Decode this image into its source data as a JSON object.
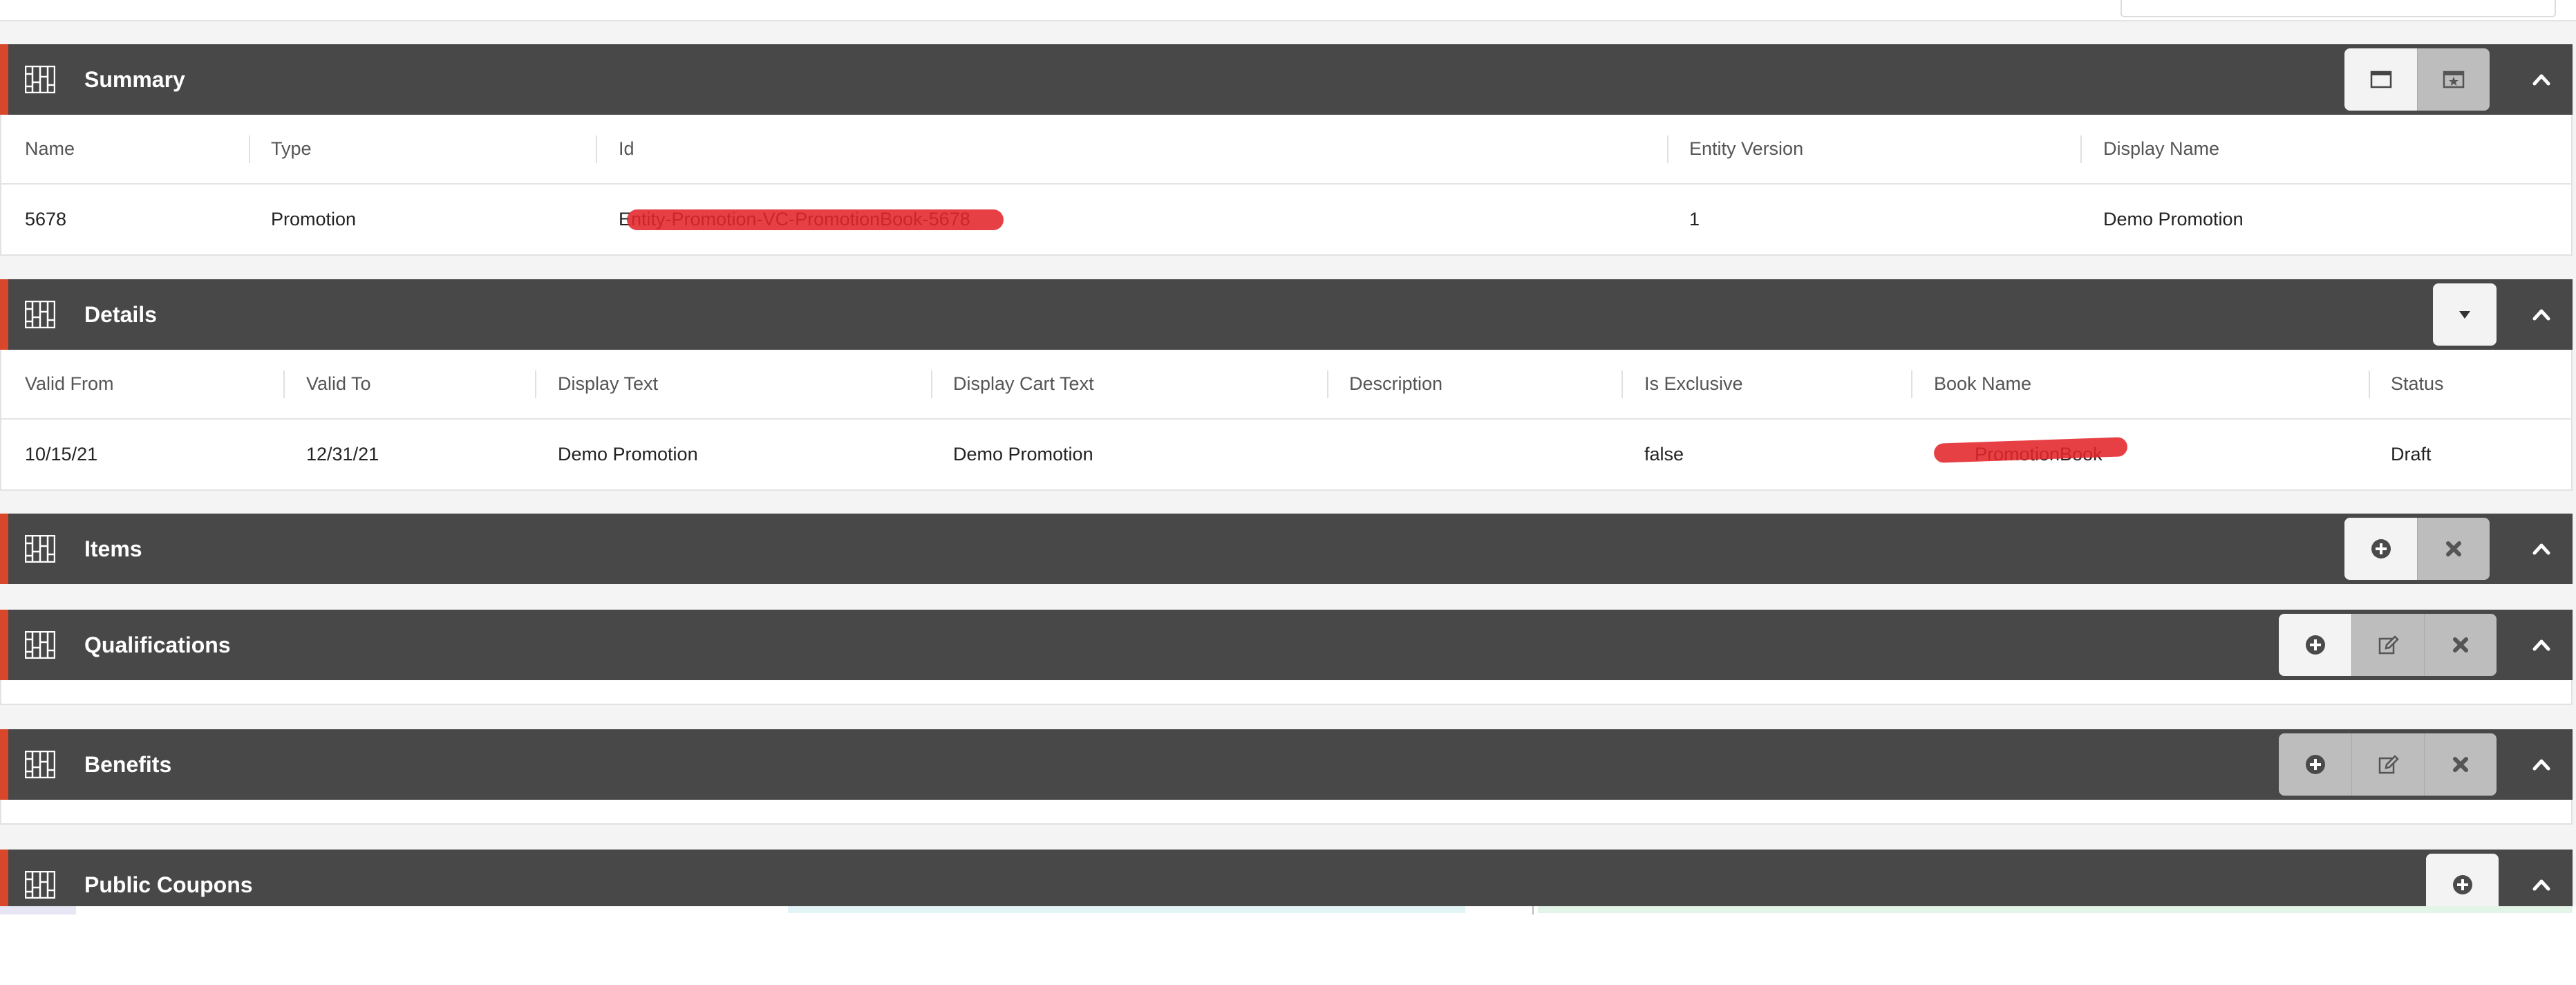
{
  "summary": {
    "title": "Summary",
    "columns": [
      "Name",
      "Type",
      "Id",
      "Entity Version",
      "Display Name"
    ],
    "row": [
      "5678",
      "Promotion",
      "Entity-Promotion-VC-PromotionBook-5678",
      "1",
      "Demo Promotion"
    ]
  },
  "details": {
    "title": "Details",
    "columns": [
      "Valid From",
      "Valid To",
      "Display Text",
      "Display Cart Text",
      "Description",
      "Is Exclusive",
      "Book Name",
      "Status"
    ],
    "row": [
      "10/15/21",
      "12/31/21",
      "Demo Promotion",
      "Demo Promotion",
      "",
      "false",
      "PromotionBook",
      "Draft"
    ]
  },
  "items": {
    "title": "Items"
  },
  "qualifications": {
    "title": "Qualifications"
  },
  "benefits": {
    "title": "Benefits"
  },
  "public_coupons": {
    "title": "Public Coupons"
  },
  "colors": {
    "header_bg": "#484848",
    "accent": "#d9472b",
    "button_light": "#f3f3f3",
    "button_gray": "#bdbdbd",
    "redaction": "#e2252a"
  },
  "icons": {
    "section": "grid-icon",
    "maximize": "window-icon",
    "favorite": "calendar-star-icon",
    "dropdown": "caret-down-icon",
    "collapse": "chevron-up-icon",
    "add": "plus-circle-icon",
    "edit": "edit-icon",
    "delete": "x-icon"
  }
}
